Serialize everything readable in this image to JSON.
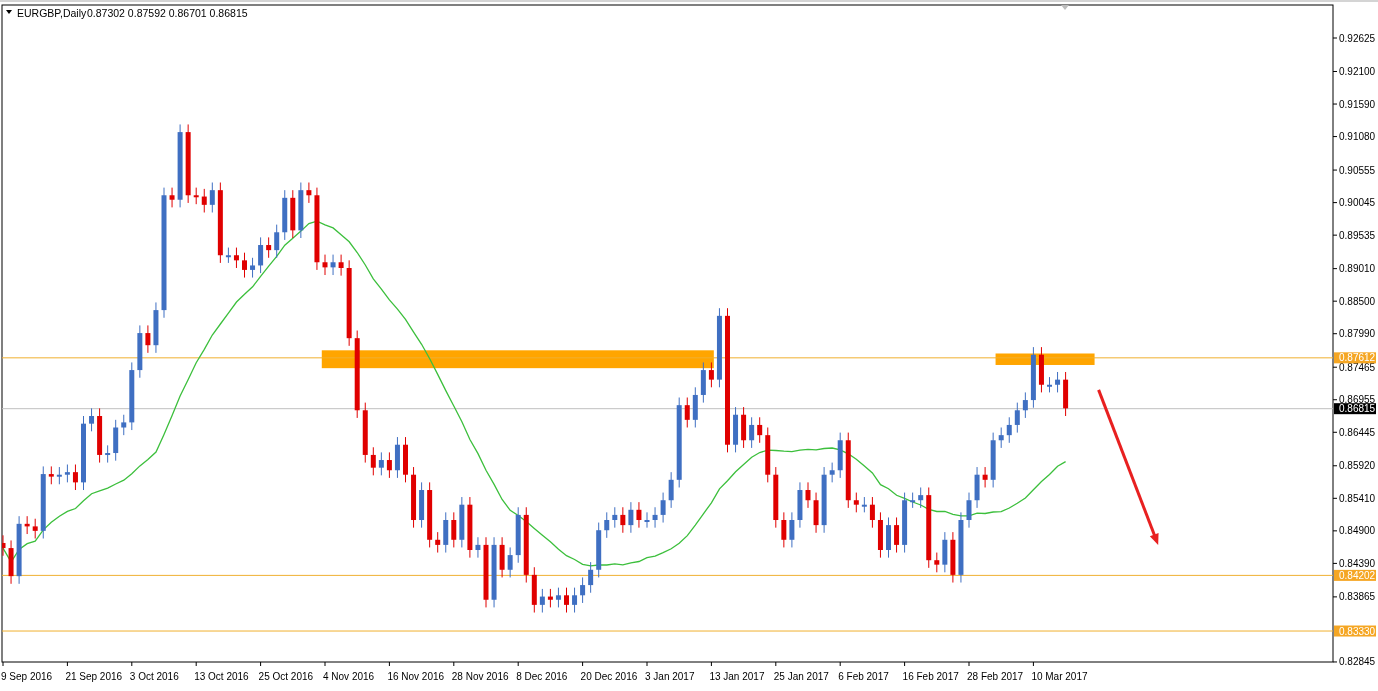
{
  "chart_header": {
    "symbol": "EURGBP,Daily",
    "ohlc": "0.87302 0.87592 0.86701 0.86815"
  },
  "price_axis": {
    "labels": [
      "0.92625",
      "0.92100",
      "0.91590",
      "0.91080",
      "0.90555",
      "0.90045",
      "0.89535",
      "0.89010",
      "0.88500",
      "0.87990",
      "0.87465",
      "0.86955",
      "0.86445",
      "0.85920",
      "0.85410",
      "0.84900",
      "0.84390",
      "0.83865",
      "0.82845"
    ]
  },
  "price_markers": [
    {
      "label": "0.87612",
      "kind": "level"
    },
    {
      "label": "0.86815",
      "kind": "current"
    },
    {
      "label": "0.84202",
      "kind": "level"
    },
    {
      "label": "0.83330",
      "kind": "level"
    }
  ],
  "date_axis": {
    "labels": [
      "9 Sep 2016",
      "21 Sep 2016",
      "3 Oct 2016",
      "13 Oct 2016",
      "25 Oct 2016",
      "4 Nov 2016",
      "16 Nov 2016",
      "28 Nov 2016",
      "8 Dec 2016",
      "20 Dec 2016",
      "3 Jan 2017",
      "13 Jan 2017",
      "25 Jan 2017",
      "6 Feb 2017",
      "16 Feb 2017",
      "28 Feb 2017",
      "10 Mar 2017"
    ]
  }
}
